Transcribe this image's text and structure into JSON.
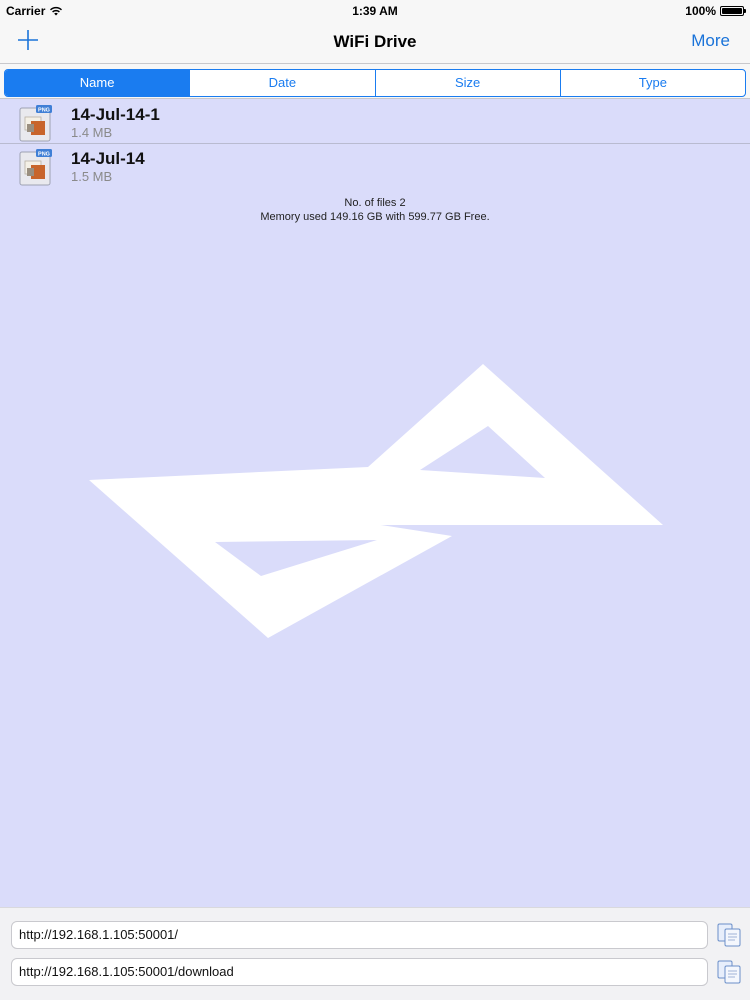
{
  "status_bar": {
    "carrier": "Carrier",
    "time": "1:39 AM",
    "battery": "100%",
    "icons": [
      "wifi-icon",
      "battery-icon"
    ]
  },
  "nav": {
    "title": "WiFi Drive",
    "left_icon": "plus-icon",
    "more_label": "More",
    "accent_color": "#1a73d9"
  },
  "sort_tabs": [
    {
      "label": "Name",
      "active": true
    },
    {
      "label": "Date",
      "active": false
    },
    {
      "label": "Size",
      "active": false
    },
    {
      "label": "Type",
      "active": false
    }
  ],
  "files": [
    {
      "name": "14-Jul-14-1",
      "size": "1.4 MB",
      "icon": "png-file-icon",
      "badge": "PNG"
    },
    {
      "name": "14-Jul-14",
      "size": "1.5 MB",
      "icon": "png-file-icon",
      "badge": "PNG"
    }
  ],
  "summary": {
    "files_count": "No. of files 2",
    "memory": "Memory used 149.16 GB with 599.77 GB Free."
  },
  "urls": [
    {
      "value": "http://192.168.1.105:50001/",
      "icon": "copy-icon"
    },
    {
      "value": "http://192.168.1.105:50001/download",
      "icon": "copy-icon"
    }
  ],
  "colors": {
    "background": "#dadcfa",
    "segment_accent": "#1a7cf0",
    "watermark": "#ffffff"
  }
}
